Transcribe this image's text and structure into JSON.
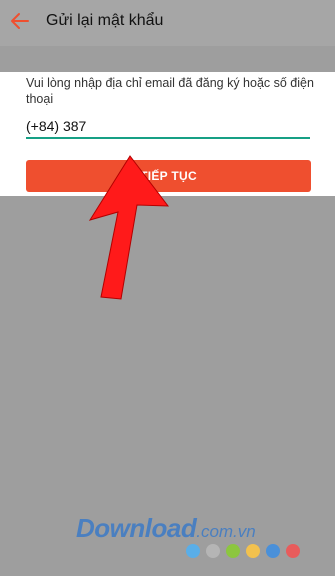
{
  "header": {
    "title": "Gửi lại mật khẩu",
    "back_icon": "arrow-left-icon",
    "accent": "#ef4f2f"
  },
  "form": {
    "instruction": "Vui lòng nhập địa chỉ email đã đăng ký hoặc số điện thoại",
    "phone_value": "(+84) 387",
    "underline_color": "#16a085",
    "continue_label": "TIẾP TỤC",
    "button_color": "#ef4f2f"
  },
  "annotation": {
    "arrow_icon": "red-arrow-pointer",
    "arrow_color": "#ff1a1a"
  },
  "watermark": {
    "word": "Download",
    "domain": ".com.vn",
    "dot_colors": [
      "#5aaee8",
      "#b5b5b5",
      "#8cc63f",
      "#f2c14e",
      "#4a90d9",
      "#e85c5c"
    ]
  }
}
